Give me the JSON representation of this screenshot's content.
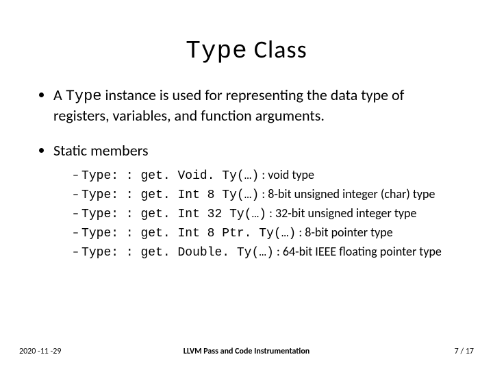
{
  "title": {
    "code": "Type",
    "word": " Class"
  },
  "bullet1": {
    "pre": "A ",
    "code": "Type",
    "post": " instance is used for representing the data type of registers, variables, and function arguments."
  },
  "bullet2": {
    "label": "Static members",
    "items": [
      {
        "code": "Type: : get. Void. Ty(…)",
        "desc": " : void type"
      },
      {
        "code": "Type: : get. Int 8 Ty(…)",
        "desc": " : 8-bit unsigned integer (char) type"
      },
      {
        "code": "Type: : get. Int 32 Ty(…)",
        "desc": " : 32-bit unsigned integer type"
      },
      {
        "code": "Type: : get. Int 8 Ptr. Ty(…)",
        "desc": " : 8-bit pointer type"
      },
      {
        "code": "Type: : get. Double. Ty(…)",
        "desc": " : 64-bit IEEE floating pointer type"
      }
    ]
  },
  "footer": {
    "date": "2020 -11 -29",
    "title": "LLVM Pass and Code Instrumentation",
    "page": "7",
    "total": "/ 17"
  }
}
